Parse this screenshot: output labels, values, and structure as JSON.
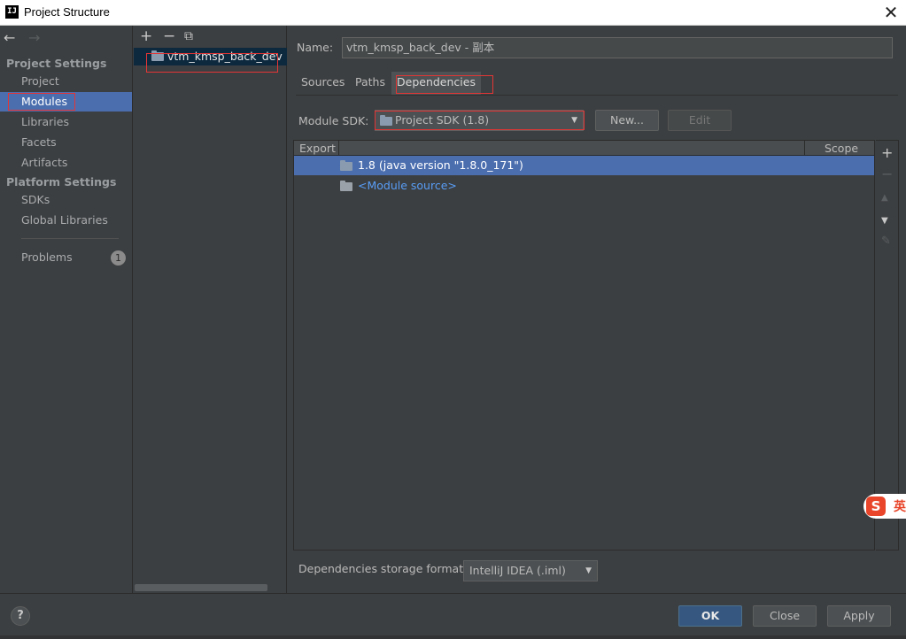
{
  "window": {
    "app_icon": "IJ",
    "title": "Project Structure",
    "close_glyph": "✕"
  },
  "nav": {
    "back_glyph": "←",
    "forward_glyph": "→",
    "project_settings_heading": "Project Settings",
    "project_items": [
      {
        "label": "Project"
      },
      {
        "label": "Modules",
        "selected": true
      },
      {
        "label": "Libraries"
      },
      {
        "label": "Facets"
      },
      {
        "label": "Artifacts"
      }
    ],
    "platform_settings_heading": "Platform Settings",
    "platform_items": [
      {
        "label": "SDKs"
      },
      {
        "label": "Global Libraries"
      }
    ],
    "problems": {
      "label": "Problems",
      "count": "1"
    }
  },
  "modules": {
    "add_glyph": "+",
    "remove_glyph": "−",
    "copy_glyph": "⧉",
    "items": [
      {
        "label": "vtm_kmsp_back_dev",
        "selected": true
      }
    ]
  },
  "module": {
    "name_label": "Name:",
    "name_value": "vtm_kmsp_back_dev - 副本",
    "tabs": [
      {
        "label": "Sources"
      },
      {
        "label": "Paths"
      },
      {
        "label": "Dependencies",
        "active": true
      }
    ],
    "sdk_label": "Module SDK:",
    "sdk_value": "Project SDK (1.8)",
    "new_button": "New...",
    "edit_button": "Edit",
    "table": {
      "col_export": "Export",
      "col_scope": "Scope",
      "rows": [
        {
          "label": "1.8 (java version \"1.8.0_171\")",
          "selected": true
        },
        {
          "label": "<Module source>",
          "selected": false
        }
      ]
    },
    "side_tools": {
      "add": "+",
      "remove": "−",
      "up": "▲",
      "down": "▼",
      "edit": "✎"
    },
    "storage_format_label": "Dependencies storage format:",
    "storage_format_value": "IntelliJ IDEA (.iml)"
  },
  "footer": {
    "help": "?",
    "ok": "OK",
    "close": "Close",
    "apply": "Apply"
  },
  "ime": {
    "logo": "S",
    "mode": "英"
  },
  "colors": {
    "accent": "#4b6eaf",
    "primary_button": "#365880",
    "highlight": "#e23535",
    "link": "#589df6"
  }
}
